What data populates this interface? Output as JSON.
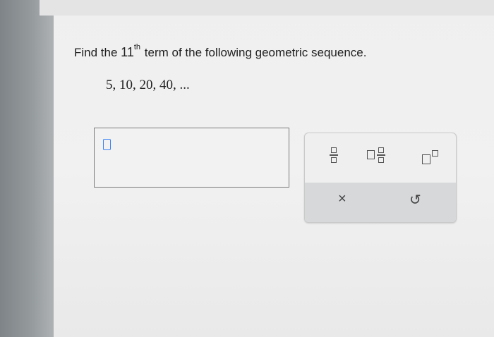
{
  "question": {
    "prefix": "Find the",
    "term_number": "11",
    "term_suffix": "th",
    "rest": "term of the following geometric sequence."
  },
  "sequence": "5, 10, 20, 40, ...",
  "answer": {
    "value": ""
  },
  "palette": {
    "tools": [
      {
        "name": "fraction",
        "icon": "fraction-icon"
      },
      {
        "name": "mixed-number",
        "icon": "mixed-number-icon"
      },
      {
        "name": "exponent",
        "icon": "exponent-icon"
      },
      {
        "name": "clear",
        "icon": "clear-x-icon",
        "glyph": "×"
      },
      {
        "name": "undo",
        "icon": "undo-icon",
        "glyph": "↺"
      }
    ]
  },
  "colors": {
    "caret": "#3b82f6",
    "palette_bottom": "#d6d8da",
    "text": "#1f1f1f"
  }
}
